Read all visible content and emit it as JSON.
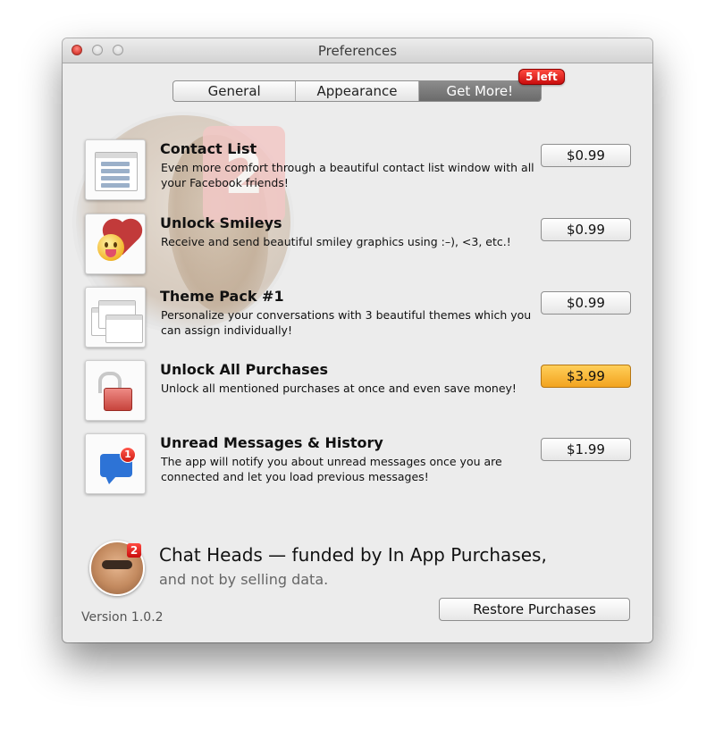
{
  "window": {
    "title": "Preferences"
  },
  "tabs": [
    {
      "label": "General"
    },
    {
      "label": "Appearance"
    },
    {
      "label": "Get More!",
      "badge": "5 left",
      "active": true
    }
  ],
  "background_badge_number": "2",
  "items": [
    {
      "title": "Contact List",
      "description": "Even more comfort through a beautiful contact list window with all your Facebook friends!",
      "price": "$0.99",
      "icon": "contact-list-window-icon",
      "highlighted": false
    },
    {
      "title": "Unlock Smileys",
      "description": "Receive and send beautiful smiley graphics using :–), <3, etc.!",
      "price": "$0.99",
      "icon": "smiley-heart-icon",
      "highlighted": false
    },
    {
      "title": "Theme Pack #1",
      "description": "Personalize your conversations with 3 beautiful themes which you can assign individually!",
      "price": "$0.99",
      "icon": "theme-windows-icon",
      "highlighted": false
    },
    {
      "title": "Unlock All Purchases",
      "description": "Unlock all mentioned purchases at once and even save money!",
      "price": "$3.99",
      "icon": "unlocked-padlock-icon",
      "highlighted": true
    },
    {
      "title": "Unread Messages & History",
      "description": "The app will notify you about unread messages once you are connected and let you load previous messages!",
      "price": "$1.99",
      "icon": "message-bubble-badge-icon",
      "highlighted": false
    }
  ],
  "unread_badge_count": "1",
  "promo": {
    "avatar_badge": "2",
    "title": "Chat Heads — funded by In App Purchases,",
    "subtitle": "and not by selling data."
  },
  "version": "Version 1.0.2",
  "restore_button": "Restore Purchases",
  "colors": {
    "highlight_price": "#f2a31f",
    "badge_red": "#d8201a",
    "active_tab": "#7a7a7a"
  }
}
